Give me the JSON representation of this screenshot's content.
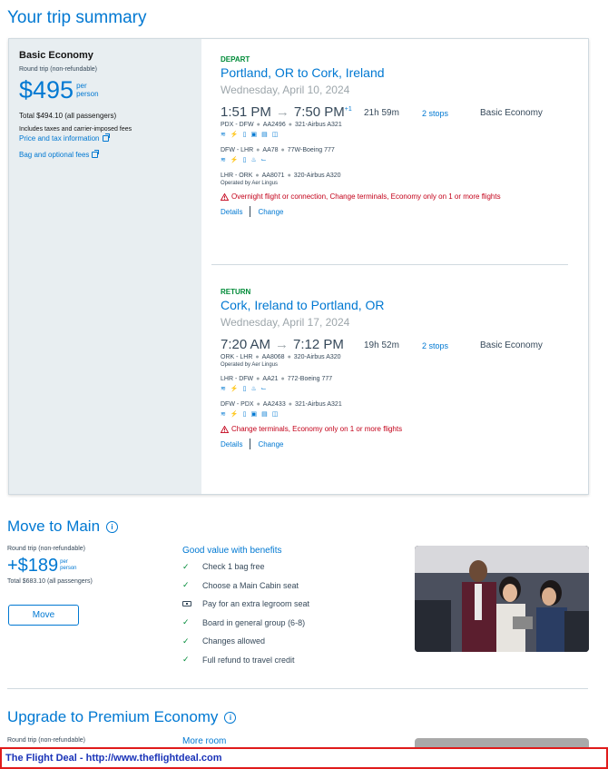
{
  "page": {
    "title": "Your trip summary"
  },
  "fare": {
    "name": "Basic Economy",
    "trip_type": "Round trip (non-refundable)",
    "price": "$495",
    "per_line1": "per",
    "per_line2": "person",
    "total": "Total $494.10 (all passengers)",
    "includes": "Includes taxes and carrier-imposed fees",
    "price_tax_link": "Price and tax information",
    "bag_link": "Bag and optional fees"
  },
  "depart": {
    "label": "DEPART",
    "route": "Portland, OR to Cork, Ireland",
    "date": "Wednesday, April 10, 2024",
    "dep_time": "1:51 PM",
    "arrow": "→",
    "arr_time": "7:50 PM",
    "day_offset": "+1",
    "duration": "21h 59m",
    "stops": "2 stops",
    "cabin": "Basic Economy",
    "segments": [
      {
        "route": "PDX - DFW",
        "flight": "AA2496",
        "aircraft": "321-Airbus A321",
        "amenities": [
          "wifi-icon",
          "power-icon",
          "usb-icon",
          "tv-icon",
          "entertainment-icon",
          "streaming-icon"
        ],
        "operated": ""
      },
      {
        "route": "DFW - LHR",
        "flight": "AA78",
        "aircraft": "77W-Boeing 777",
        "amenities": [
          "wifi-icon",
          "power-icon",
          "usb-icon",
          "meal-icon",
          "lieflat-icon"
        ],
        "operated": ""
      },
      {
        "route": "LHR - ORK",
        "flight": "AA8071",
        "aircraft": "320-Airbus A320",
        "amenities": [],
        "operated": "Operated by Aer Lingus"
      }
    ],
    "warning": "Overnight flight or connection, Change terminals, Economy only on 1 or more flights",
    "details_label": "Details",
    "change_label": "Change"
  },
  "return": {
    "label": "RETURN",
    "route": "Cork, Ireland to Portland, OR",
    "date": "Wednesday, April 17, 2024",
    "dep_time": "7:20 AM",
    "arrow": "→",
    "arr_time": "7:12 PM",
    "duration": "19h 52m",
    "stops": "2 stops",
    "cabin": "Basic Economy",
    "segments": [
      {
        "route": "ORK - LHR",
        "flight": "AA8068",
        "aircraft": "320-Airbus A320",
        "amenities": [],
        "operated": "Operated by Aer Lingus"
      },
      {
        "route": "LHR - DFW",
        "flight": "AA21",
        "aircraft": "772-Boeing 777",
        "amenities": [
          "wifi-icon",
          "power-icon",
          "usb-icon",
          "meal-icon",
          "lieflat-icon"
        ],
        "operated": ""
      },
      {
        "route": "DFW - PDX",
        "flight": "AA2433",
        "aircraft": "321-Airbus A321",
        "amenities": [
          "wifi-icon",
          "power-icon",
          "usb-icon",
          "tv-icon",
          "entertainment-icon",
          "streaming-icon"
        ],
        "operated": ""
      }
    ],
    "warning": "Change terminals, Economy only on 1 or more flights",
    "details_label": "Details",
    "change_label": "Change"
  },
  "move_to_main": {
    "title": "Move to Main",
    "trip_type": "Round trip (non-refundable)",
    "price": "+$189",
    "per_line1": "per",
    "per_line2": "person",
    "total": "Total $683.10 (all passengers)",
    "button": "Move",
    "benefits_title": "Good value with benefits",
    "benefits": [
      {
        "icon": "check-icon",
        "text": "Check 1 bag free"
      },
      {
        "icon": "check-icon",
        "text": "Choose a Main Cabin seat"
      },
      {
        "icon": "seat-icon",
        "text": "Pay for an extra legroom seat"
      },
      {
        "icon": "check-icon",
        "text": "Board in general group (6-8)"
      },
      {
        "icon": "check-icon",
        "text": "Changes allowed"
      },
      {
        "icon": "check-icon",
        "text": "Full refund to travel credit"
      }
    ]
  },
  "upgrade": {
    "title": "Upgrade to Premium Economy",
    "trip_type": "Round trip (non-refundable)",
    "more": "More room"
  },
  "banner": {
    "text": "The Flight Deal - http://www.theflightdeal.com"
  },
  "colors": {
    "accent": "#0078d2",
    "success": "#008b38",
    "warning": "#c30019",
    "panel": "#e8eef1"
  }
}
